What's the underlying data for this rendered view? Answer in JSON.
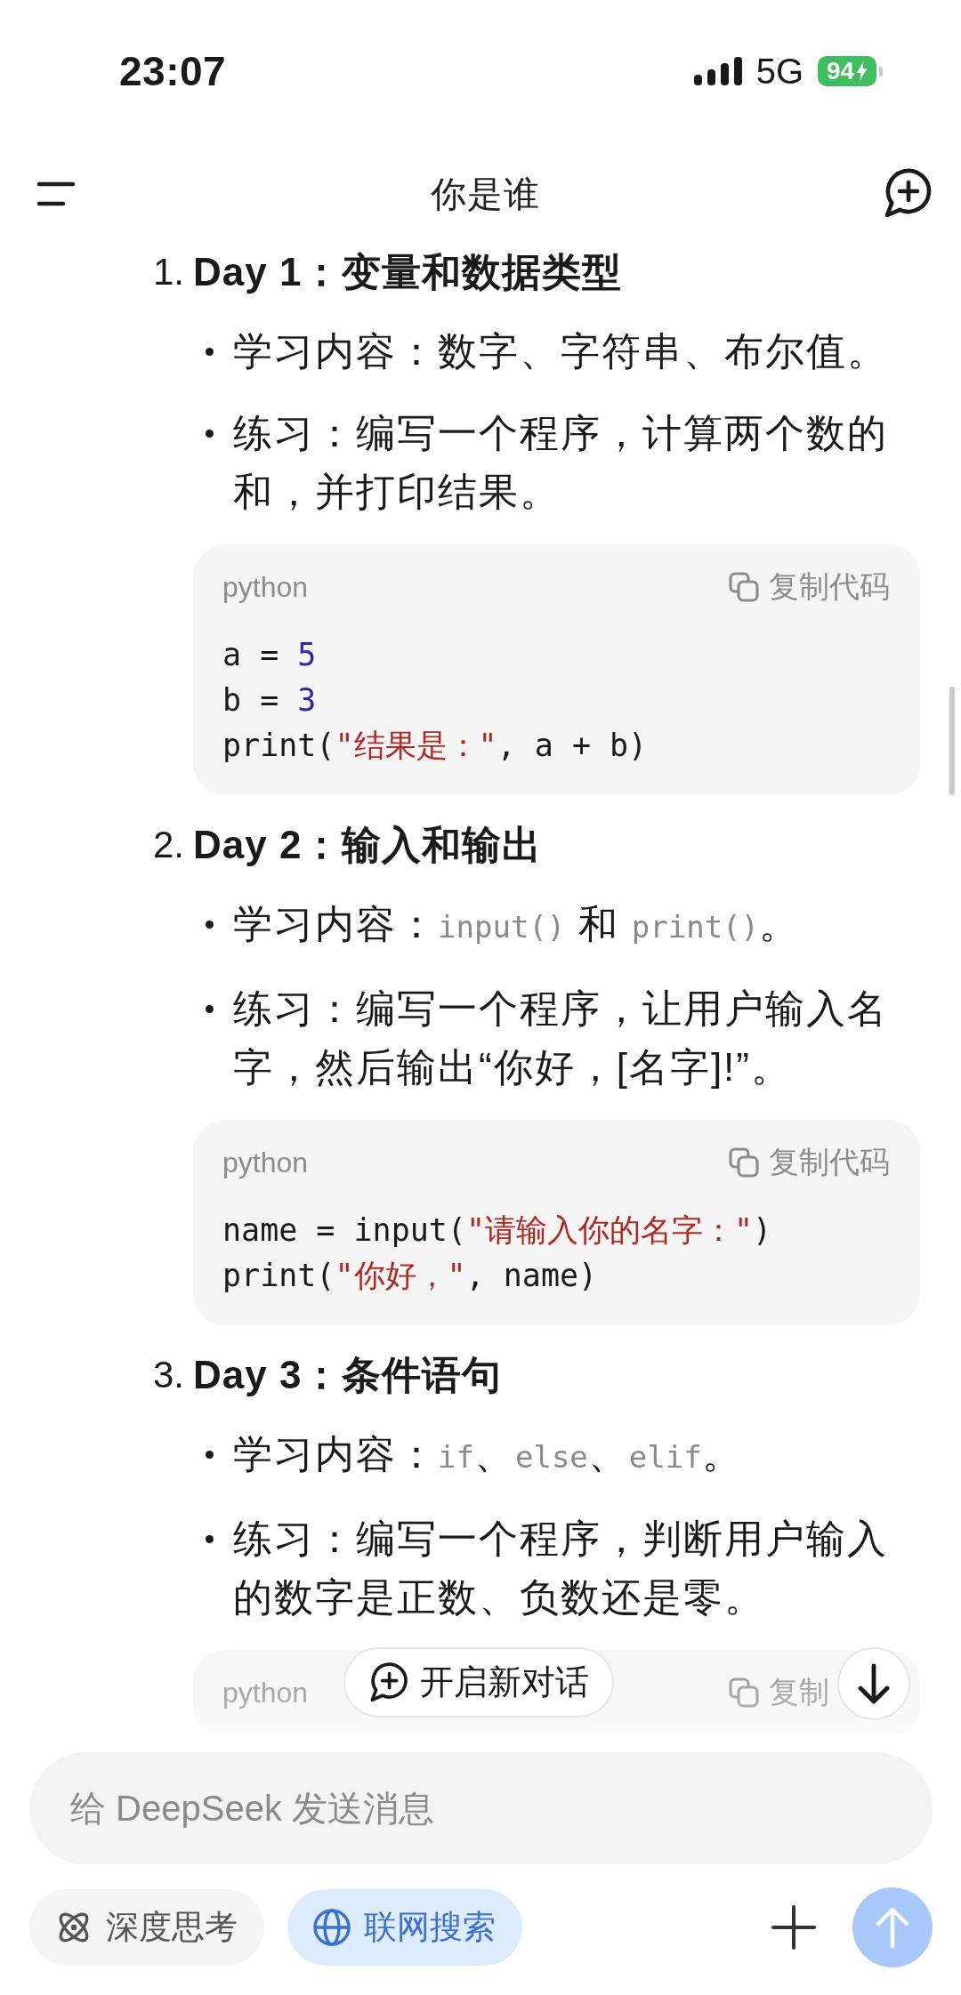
{
  "status_bar": {
    "time": "23:07",
    "network": "5G",
    "battery": "94",
    "charging": true
  },
  "header": {
    "title": "你是谁"
  },
  "sections": [
    {
      "number": "1.",
      "title": "Day 1：变量和数据类型",
      "bullets": [
        {
          "segments": [
            {
              "kind": "text",
              "text": "学习内容：数字、字符串、布尔值。"
            }
          ]
        },
        {
          "segments": [
            {
              "kind": "text",
              "text": "练习：编写一个程序，计算两个数的和，并打印结果。"
            }
          ]
        }
      ],
      "code": {
        "language": "python",
        "copy_label": "复制代码",
        "lines": [
          [
            {
              "kind": "plain",
              "text": "a = "
            },
            {
              "kind": "number",
              "text": "5"
            }
          ],
          [
            {
              "kind": "plain",
              "text": "b = "
            },
            {
              "kind": "number",
              "text": "3"
            }
          ],
          [
            {
              "kind": "plain",
              "text": "print("
            },
            {
              "kind": "string",
              "text": "\"结果是：\""
            },
            {
              "kind": "plain",
              "text": ", a + b)"
            }
          ]
        ]
      }
    },
    {
      "number": "2.",
      "title": "Day 2：输入和输出",
      "bullets": [
        {
          "segments": [
            {
              "kind": "text",
              "text": "学习内容："
            },
            {
              "kind": "code",
              "text": "input()"
            },
            {
              "kind": "text",
              "text": " 和 "
            },
            {
              "kind": "code",
              "text": "print()"
            },
            {
              "kind": "text",
              "text": "。"
            }
          ]
        },
        {
          "segments": [
            {
              "kind": "text",
              "text": "练习：编写一个程序，让用户输入名字，然后输出“你好，[名字]!”。"
            }
          ]
        }
      ],
      "code": {
        "language": "python",
        "copy_label": "复制代码",
        "lines": [
          [
            {
              "kind": "plain",
              "text": "name = input("
            },
            {
              "kind": "string",
              "text": "\"请输入你的名字：\""
            },
            {
              "kind": "plain",
              "text": ")"
            }
          ],
          [
            {
              "kind": "plain",
              "text": "print("
            },
            {
              "kind": "string",
              "text": "\"你好，\""
            },
            {
              "kind": "plain",
              "text": ", name)"
            }
          ]
        ]
      }
    },
    {
      "number": "3.",
      "title": "Day 3：条件语句",
      "bullets": [
        {
          "segments": [
            {
              "kind": "text",
              "text": "学习内容："
            },
            {
              "kind": "code",
              "text": "if"
            },
            {
              "kind": "text",
              "text": "、"
            },
            {
              "kind": "code",
              "text": "else"
            },
            {
              "kind": "text",
              "text": "、"
            },
            {
              "kind": "code",
              "text": "elif"
            },
            {
              "kind": "text",
              "text": "。"
            }
          ]
        },
        {
          "segments": [
            {
              "kind": "text",
              "text": "练习：编写一个程序，判断用户输入的数字是正数、负数还是零。"
            }
          ]
        }
      ],
      "code": {
        "language": "python",
        "copy_label": "复制"
      }
    }
  ],
  "new_chat_button": {
    "label": "开启新对话"
  },
  "composer": {
    "placeholder": "给 DeepSeek 发送消息",
    "toggles": [
      {
        "kind": "think",
        "label": "深度思考",
        "selected": false
      },
      {
        "kind": "search",
        "label": "联网搜索",
        "selected": true
      }
    ],
    "send_button": {
      "disabled": true
    }
  }
}
